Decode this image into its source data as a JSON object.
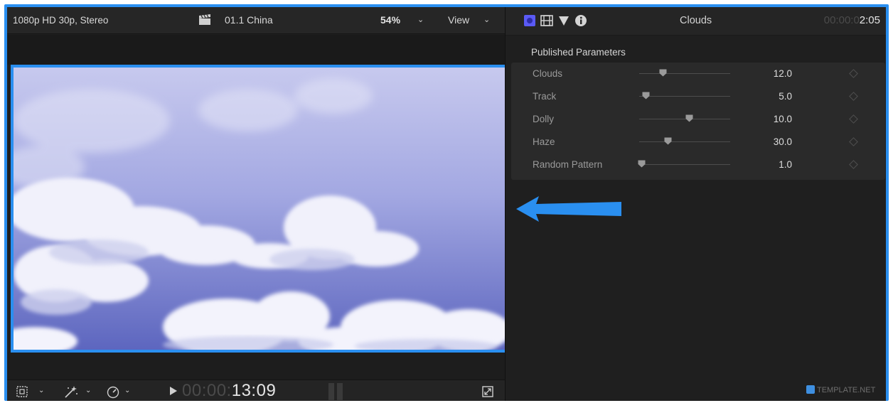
{
  "viewer": {
    "format": "1080p HD 30p, Stereo",
    "clip_name": "01.1 China",
    "zoom": "54%",
    "view_menu": "View",
    "timecode_dim": "00:00:",
    "timecode_lit": "13:09"
  },
  "inspector": {
    "title": "Clouds",
    "timecode_dim": "00:00:0",
    "timecode_lit": "2:05",
    "published_parameters_title": "Published Parameters",
    "parameters": [
      {
        "label": "Clouds",
        "value": "12.0",
        "slider_fraction": 0.26
      },
      {
        "label": "Track",
        "value": "5.0",
        "slider_fraction": 0.07
      },
      {
        "label": "Dolly",
        "value": "10.0",
        "slider_fraction": 0.55
      },
      {
        "label": "Haze",
        "value": "30.0",
        "slider_fraction": 0.31
      },
      {
        "label": "Random Pattern",
        "value": "1.0",
        "slider_fraction": 0.02
      }
    ]
  },
  "watermark": "TEMPLATE.NET",
  "icons": [
    "clapper-icon",
    "transform-icon",
    "enhance-icon",
    "speed-icon",
    "play-icon",
    "fullscreen-icon",
    "generator-icon",
    "video-icon",
    "color-icon",
    "info-icon",
    "left-arrow-icon"
  ],
  "colors": {
    "accent": "#2a8ff0",
    "background": "#1e1e1e",
    "panel": "#2a2a2a"
  }
}
